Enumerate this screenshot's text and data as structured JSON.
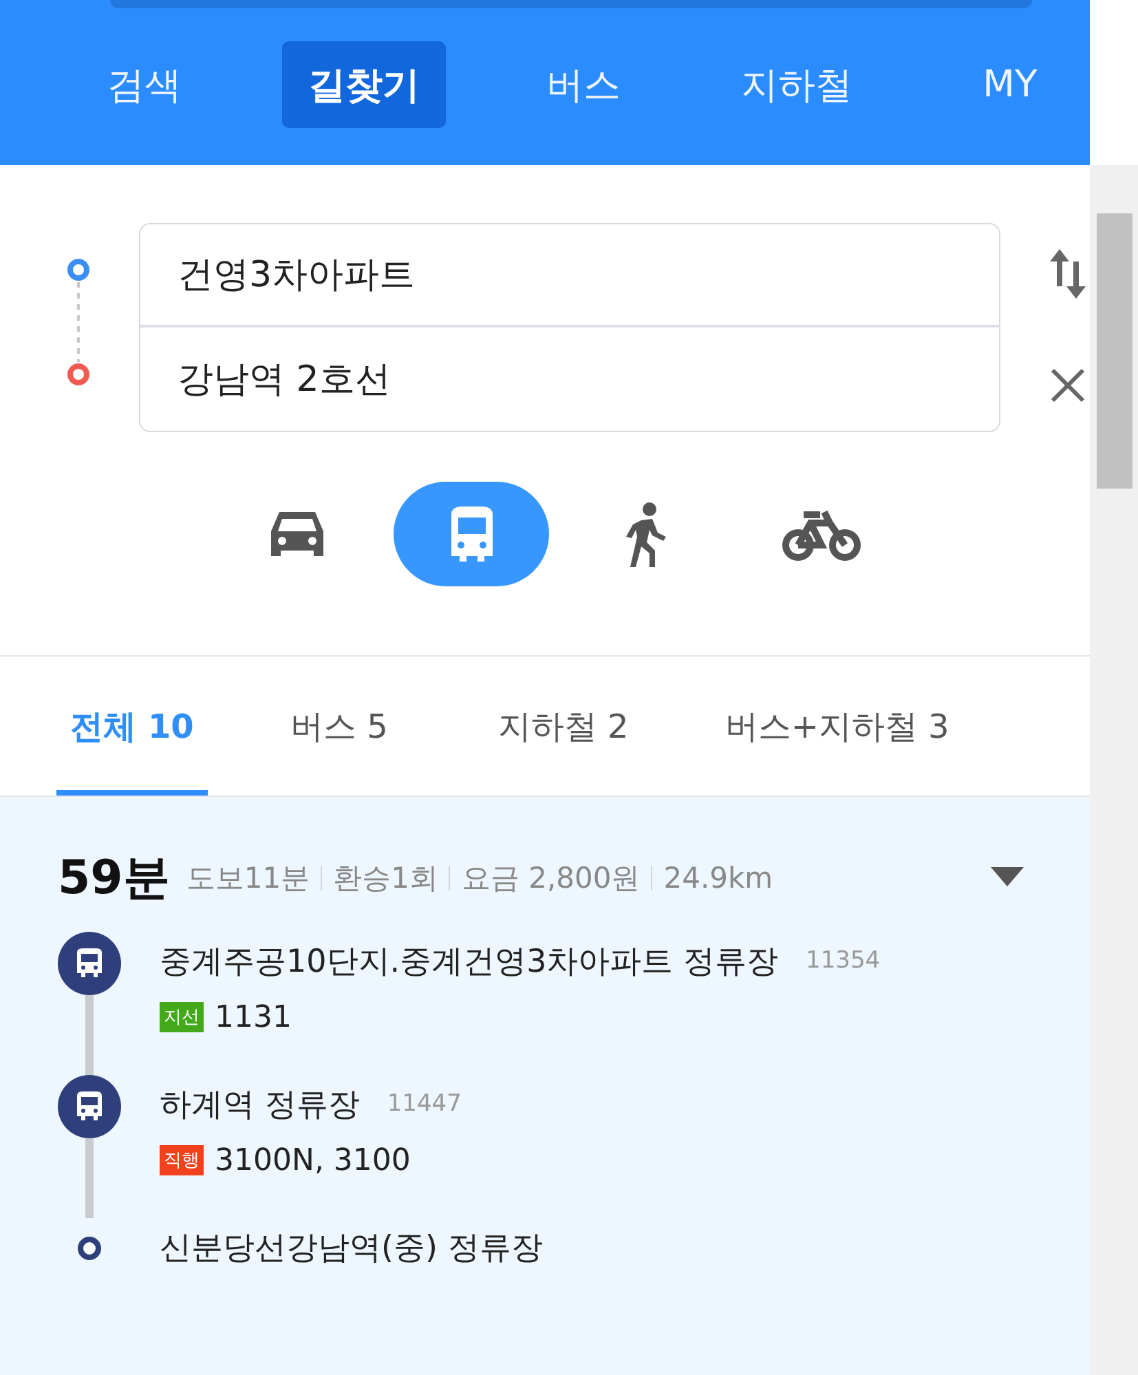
{
  "nav": [
    {
      "label": "검색",
      "selected": false
    },
    {
      "label": "길찾기",
      "selected": true
    },
    {
      "label": "버스",
      "selected": false
    },
    {
      "label": "지하철",
      "selected": false
    },
    {
      "label": "MY",
      "selected": false
    }
  ],
  "route_inputs": {
    "origin": "건영3차아파트",
    "destination": "강남역 2호선"
  },
  "modes": [
    {
      "kind": "car",
      "selected": false
    },
    {
      "kind": "bus",
      "selected": true
    },
    {
      "kind": "walk",
      "selected": false
    },
    {
      "kind": "bike",
      "selected": false
    }
  ],
  "result_tabs": [
    {
      "label": "전체 10",
      "selected": true
    },
    {
      "label": "버스 5",
      "selected": false
    },
    {
      "label": "지하철 2",
      "selected": false
    },
    {
      "label": "버스+지하철 3",
      "selected": false
    }
  ],
  "route": {
    "duration": "59분",
    "details": [
      "도보11분",
      "환승1회",
      "요금 2,800원",
      "24.9km"
    ],
    "steps": [
      {
        "kind": "bus",
        "stop": "중계주공10단지.중계건영3차아파트 정류장",
        "stop_id": "11354",
        "badge": {
          "label": "지선",
          "color": "#43a91a"
        },
        "lines": "1131"
      },
      {
        "kind": "bus",
        "stop": "하계역 정류장",
        "stop_id": "11447",
        "badge": {
          "label": "직행",
          "color": "#f2421d"
        },
        "lines": "3100N, 3100"
      },
      {
        "kind": "end",
        "stop": "신분당선강남역(중) 정류장"
      }
    ]
  }
}
